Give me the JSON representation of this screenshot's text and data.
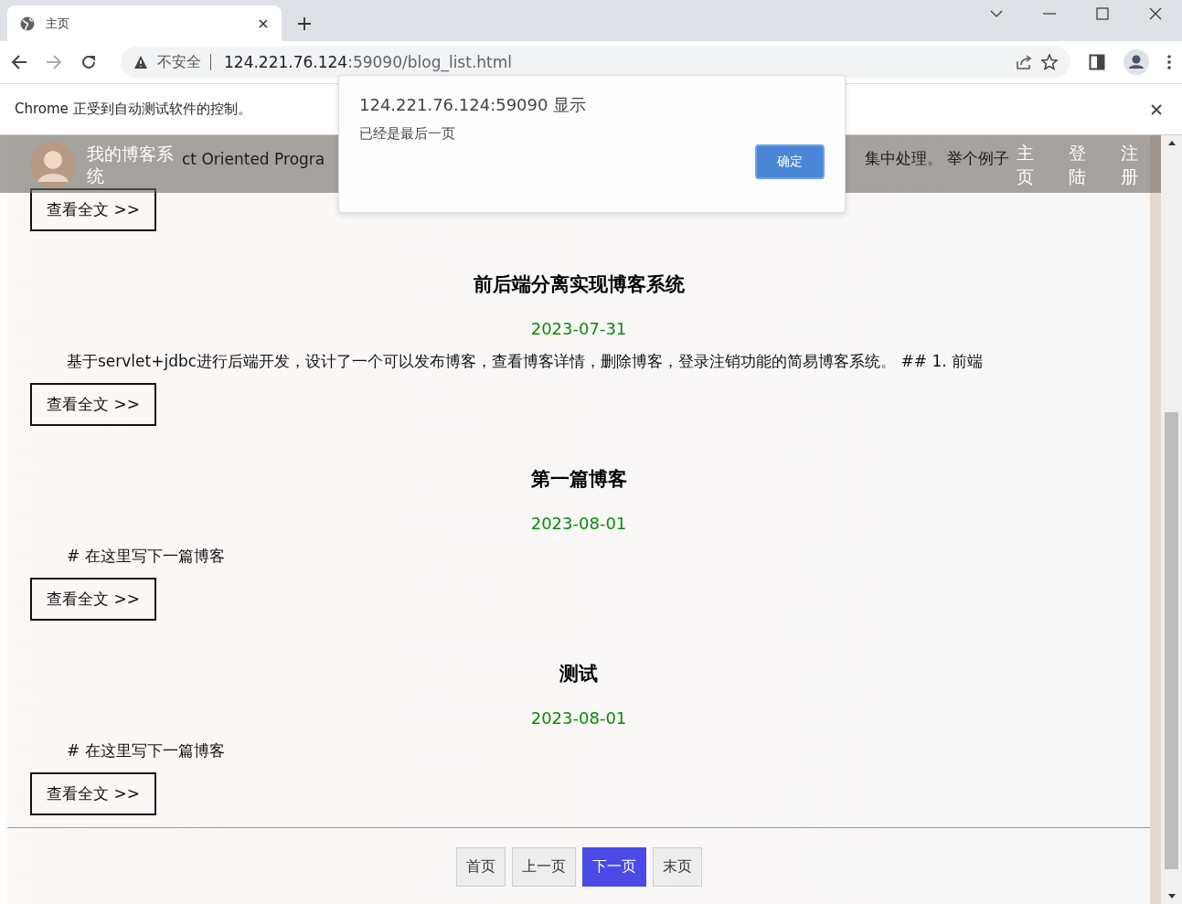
{
  "browser": {
    "tab": {
      "title": "主页"
    },
    "address": {
      "security": "不安全",
      "url_host": "124.221.76.124",
      "url_rest": ":59090/blog_list.html"
    },
    "infobar": "Chrome 正受到自动测试软件的控制。"
  },
  "nav": {
    "title": "我的博客系统",
    "links": [
      "主页",
      "登陆",
      "注册"
    ]
  },
  "articles": [
    {
      "summary_parts": [
        "ct Oriented Progra",
        "集中处理。 举个例子"
      ],
      "button": "查看全文 >>"
    },
    {
      "title": "前后端分离实现博客系统",
      "date": "2023-07-31",
      "summary": "基于servlet+jdbc进行后端开发，设计了一个可以发布博客，查看博客详情，删除博客，登录注销功能的简易博客系统。 ## 1. 前端",
      "button": "查看全文 >>"
    },
    {
      "title": "第一篇博客",
      "date": "2023-08-01",
      "summary": "# 在这里写下一篇博客",
      "button": "查看全文 >>"
    },
    {
      "title": "测试",
      "date": "2023-08-01",
      "summary": "# 在这里写下一篇博客",
      "button": "查看全文 >>"
    }
  ],
  "pagination": [
    {
      "label": "首页",
      "selected": false
    },
    {
      "label": "上一页",
      "selected": false
    },
    {
      "label": "下一页",
      "selected": true
    },
    {
      "label": "末页",
      "selected": false
    }
  ],
  "dialog": {
    "title": "124.221.76.124:59090 显示",
    "message": "已经是最后一页",
    "button": "确定"
  }
}
